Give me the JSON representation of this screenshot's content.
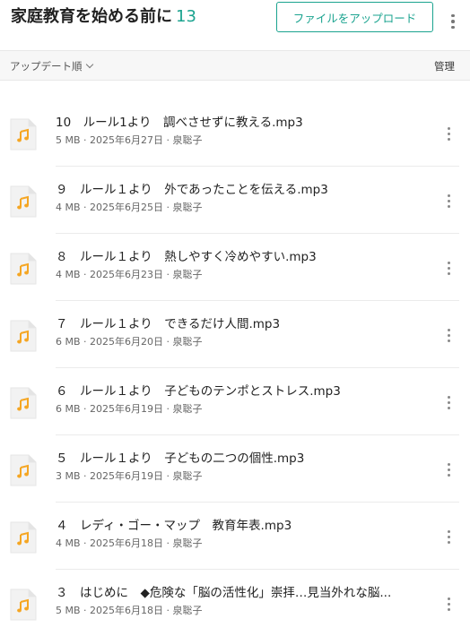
{
  "header": {
    "title": "家庭教育を始める前に",
    "count": "13",
    "upload_label": "ファイルをアップロード"
  },
  "toolbar": {
    "sort_label": "アップデート順",
    "manage_label": "管理"
  },
  "colors": {
    "accent": "#1aa38f",
    "music_icon": "#f5a623"
  },
  "files": [
    {
      "name": "10　ルール1より　調べさせずに教える.mp3",
      "size": "5 MB",
      "date": "2025年6月27日",
      "author": "泉聡子"
    },
    {
      "name": "９　ルール１より　外であったことを伝える.mp3",
      "size": "4 MB",
      "date": "2025年6月25日",
      "author": "泉聡子"
    },
    {
      "name": "８　ルール１より　熱しやすく冷めやすい.mp3",
      "size": "4 MB",
      "date": "2025年6月23日",
      "author": "泉聡子"
    },
    {
      "name": "７　ルール１より　できるだけ人間.mp3",
      "size": "6 MB",
      "date": "2025年6月20日",
      "author": "泉聡子"
    },
    {
      "name": "６　ルール１より　子どものテンポとストレス.mp3",
      "size": "6 MB",
      "date": "2025年6月19日",
      "author": "泉聡子"
    },
    {
      "name": "５　ルール１より　子どもの二つの個性.mp3",
      "size": "3 MB",
      "date": "2025年6月19日",
      "author": "泉聡子"
    },
    {
      "name": "４　レディ・ゴー・マップ　教育年表.mp3",
      "size": "4 MB",
      "date": "2025年6月18日",
      "author": "泉聡子"
    },
    {
      "name": "３　はじめに　◆危険な「脳の活性化」崇拝…見当外れな脳...",
      "size": "5 MB",
      "date": "2025年6月18日",
      "author": "泉聡子"
    }
  ]
}
